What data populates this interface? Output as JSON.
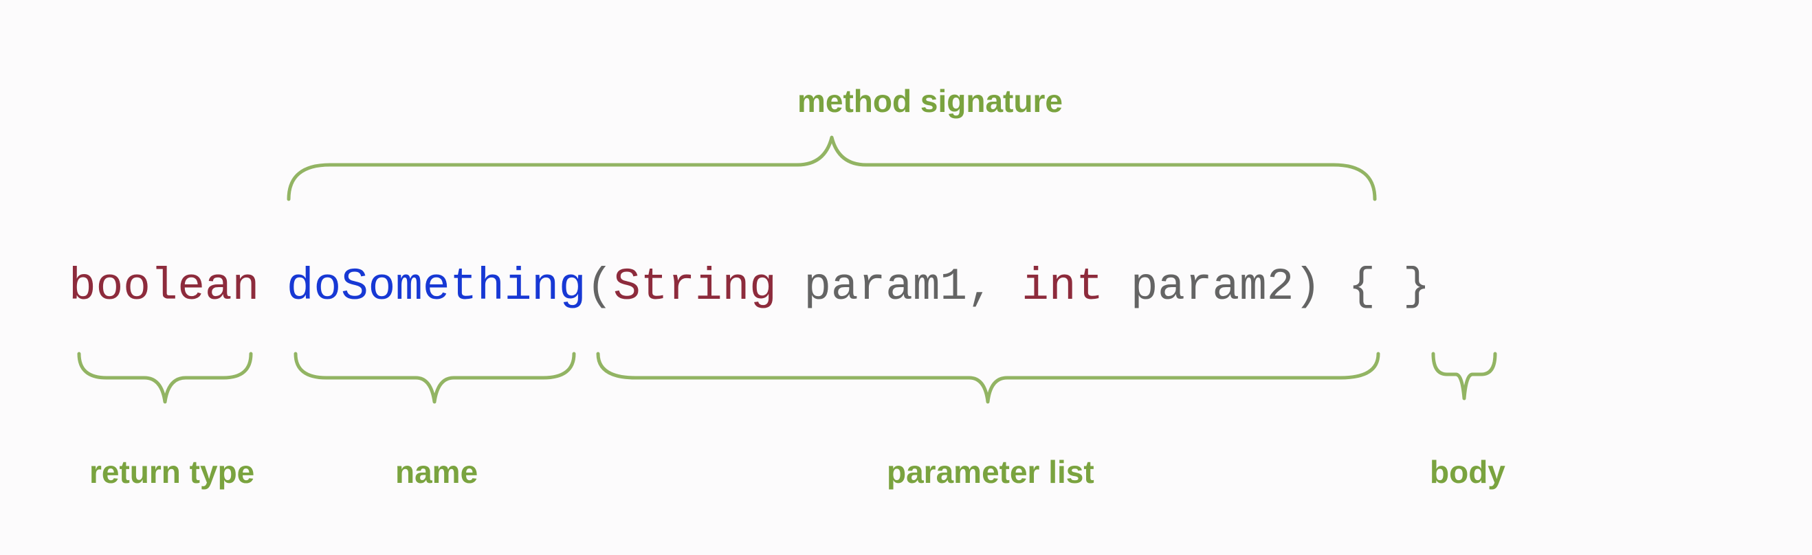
{
  "labels": {
    "method_signature": "method signature",
    "return_type": "return type",
    "name": "name",
    "parameter_list": "parameter list",
    "body": "body"
  },
  "code": {
    "return_type": "boolean",
    "space1": " ",
    "method_name": "doSomething",
    "paren_open": "(",
    "param1_type": "String",
    "space2": " ",
    "param1_name": "param1",
    "comma": ", ",
    "param2_type": "int",
    "space3": " ",
    "param2_name": "param2",
    "paren_close": ")",
    "space4": " ",
    "brace_open": "{",
    "space5": " ",
    "brace_close": "}"
  }
}
